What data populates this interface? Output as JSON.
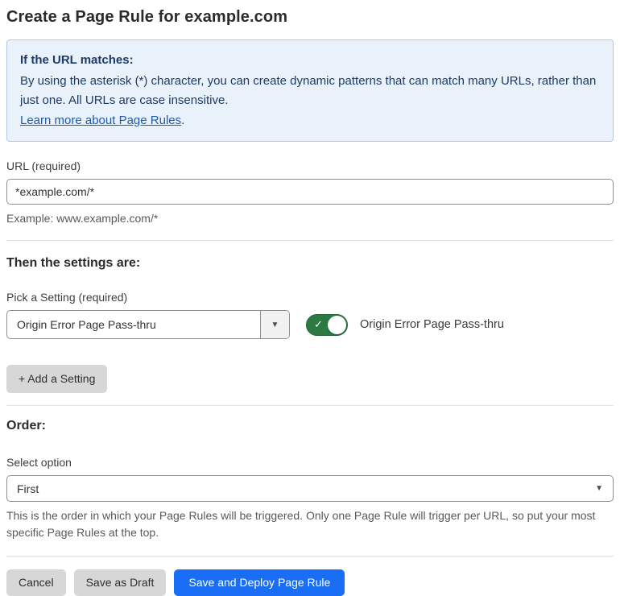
{
  "page": {
    "title": "Create a Page Rule for example.com"
  },
  "info_box": {
    "heading": "If the URL matches:",
    "body": "By using the asterisk (*) character, you can create dynamic patterns that can match many URLs, rather than just one. All URLs are case insensitive.",
    "link_label": "Learn more about Page Rules",
    "link_suffix": "."
  },
  "url_field": {
    "label": "URL (required)",
    "value": "*example.com/*",
    "helper": "Example: www.example.com/*"
  },
  "settings_section": {
    "heading": "Then the settings are:",
    "picker_label": "Pick a Setting (required)",
    "picker_value": "Origin Error Page Pass-thru",
    "toggle_state": "on",
    "toggle_label": "Origin Error Page Pass-thru",
    "add_setting_label": "+ Add a Setting"
  },
  "order_section": {
    "heading": "Order:",
    "select_label": "Select option",
    "select_value": "First",
    "helper": "This is the order in which your Page Rules will be triggered. Only one Page Rule will trigger per URL, so put your most specific Page Rules at the top."
  },
  "actions": {
    "cancel_label": "Cancel",
    "save_draft_label": "Save as Draft",
    "save_deploy_label": "Save and Deploy Page Rule"
  },
  "icons": {
    "caret_down": "▼",
    "check": "✓"
  },
  "colors": {
    "info_bg": "#e9f1fb",
    "info_border": "#abc9e8",
    "info_text": "#1e3a66",
    "link_blue": "#1d5bb0",
    "toggle_on_green": "#2c7a41",
    "primary_button_blue": "#1a6ef5",
    "gray_button": "#d7d7d7",
    "input_border": "#8f8f8f",
    "divider": "#e2e2e2"
  }
}
